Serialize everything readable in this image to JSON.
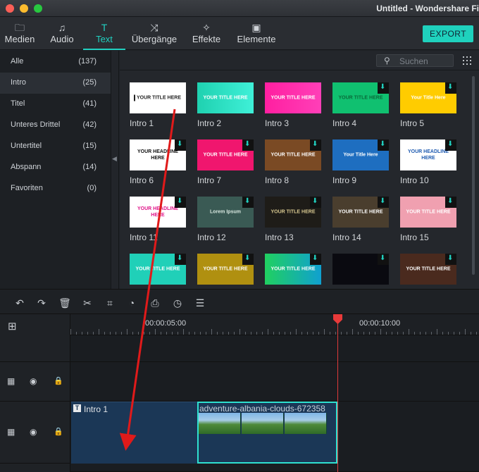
{
  "window": {
    "title": "Untitled - Wondershare Fi"
  },
  "tabs": [
    {
      "label": "Medien",
      "icon": "folder-icon",
      "glyph": "🗀"
    },
    {
      "label": "Audio",
      "icon": "music-note-icon",
      "glyph": "♫"
    },
    {
      "label": "Text",
      "icon": "text-icon",
      "glyph": "T"
    },
    {
      "label": "Übergänge",
      "icon": "transition-icon",
      "glyph": "⤨"
    },
    {
      "label": "Effekte",
      "icon": "effects-icon",
      "glyph": "✧"
    },
    {
      "label": "Elemente",
      "icon": "image-icon",
      "glyph": "▣"
    }
  ],
  "export_label": "EXPORT",
  "categories": [
    {
      "label": "Alle",
      "count": "(137)"
    },
    {
      "label": "Intro",
      "count": "(25)"
    },
    {
      "label": "Titel",
      "count": "(41)"
    },
    {
      "label": "Unteres Drittel",
      "count": "(42)"
    },
    {
      "label": "Untertitel",
      "count": "(15)"
    },
    {
      "label": "Abspann",
      "count": "(14)"
    },
    {
      "label": "Favoriten",
      "count": "(0)"
    }
  ],
  "search": {
    "placeholder": "Suchen"
  },
  "items": [
    {
      "label": "Intro 1",
      "thumb_text": "YOUR TITLE HERE",
      "bg": "#ffffff",
      "fg": "#222222",
      "download": false
    },
    {
      "label": "Intro 2",
      "thumb_text": "YOUR TITLE HERE",
      "bg": "linear-gradient(90deg,#1fd1b0,#3ff0d8)",
      "fg": "#ffffff",
      "download": false
    },
    {
      "label": "Intro 3",
      "thumb_text": "YOUR TITLE HERE",
      "bg": "linear-gradient(90deg,#ff1fa0,#ff3fb8)",
      "fg": "#ffffff",
      "download": false
    },
    {
      "label": "Intro 4",
      "thumb_text": "YOUR TITLE HERE",
      "bg": "#10c070",
      "fg": "#0a6a3a",
      "download": true
    },
    {
      "label": "Intro 5",
      "thumb_text": "Your Title Here",
      "bg": "#ffcc00",
      "fg": "#ffffff",
      "download": true
    },
    {
      "label": "Intro 6",
      "thumb_text": "YOUR HEADLINE HERE",
      "bg": "#ffffff",
      "fg": "#111111",
      "download": true
    },
    {
      "label": "Intro 7",
      "thumb_text": "YOUR TITLE HERE",
      "bg": "#f0166e",
      "fg": "#ffffff",
      "download": true
    },
    {
      "label": "Intro 8",
      "thumb_text": "YOUR TITLE HERE",
      "bg": "#7a4a24",
      "fg": "#ffffff",
      "download": true
    },
    {
      "label": "Intro 9",
      "thumb_text": "Your Title Here",
      "bg": "#1e6ec0",
      "fg": "#ffffff",
      "download": true
    },
    {
      "label": "Intro 10",
      "thumb_text": "YOUR HEADLINE HERE",
      "bg": "#ffffff",
      "fg": "#1e5ab0",
      "download": true
    },
    {
      "label": "Intro 11",
      "thumb_text": "YOUR HEADLINE HERE",
      "bg": "#ffffff",
      "fg": "#e0168a",
      "download": true
    },
    {
      "label": "Intro 12",
      "thumb_text": "Lorem Ipsum",
      "bg": "#3a5a54",
      "fg": "#d8e8e0",
      "download": true
    },
    {
      "label": "Intro 13",
      "thumb_text": "YOUR TITLE HERE",
      "bg": "#1e1c18",
      "fg": "#d8c890",
      "download": true
    },
    {
      "label": "Intro 14",
      "thumb_text": "YOUR TITLE HERE",
      "bg": "#4a3e2e",
      "fg": "#ffffff",
      "download": true
    },
    {
      "label": "Intro 15",
      "thumb_text": "YOUR TITLE HERE",
      "bg": "#f0a0b0",
      "fg": "#ffffff",
      "download": true
    },
    {
      "label": "",
      "thumb_text": "YOUR TITLE HERE",
      "bg": "#20d0b8",
      "fg": "#ffffff",
      "download": true
    },
    {
      "label": "",
      "thumb_text": "YOUR TITLE HERE",
      "bg": "#b09010",
      "fg": "#ffffff",
      "download": true
    },
    {
      "label": "",
      "thumb_text": "YOUR TITLE HERE",
      "bg": "linear-gradient(90deg,#20d060,#10a0d0)",
      "fg": "#ffffff",
      "download": true
    },
    {
      "label": "",
      "thumb_text": "",
      "bg": "#0a0a10",
      "fg": "#ffffff",
      "download": true
    },
    {
      "label": "",
      "thumb_text": "YOUR TITLE HERE",
      "bg": "#4a2a1e",
      "fg": "#ffffff",
      "download": true
    }
  ],
  "edit_tools": [
    {
      "icon": "undo-icon",
      "glyph": "↶"
    },
    {
      "icon": "redo-icon",
      "glyph": "↷"
    },
    {
      "icon": "trash-icon",
      "glyph": "🗑"
    },
    {
      "icon": "scissors-icon",
      "glyph": "✂"
    },
    {
      "icon": "crop-icon",
      "glyph": "⌗"
    },
    {
      "icon": "speed-icon",
      "glyph": "◔"
    },
    {
      "icon": "snapshot-icon",
      "glyph": "⎙"
    },
    {
      "icon": "clock-icon",
      "glyph": "◷"
    },
    {
      "icon": "adjust-icon",
      "glyph": "☰"
    }
  ],
  "timeline": {
    "markers": [
      "00:00:05:00",
      "00:00:10:00"
    ],
    "title_clip": "Intro 1",
    "video_clip": "adventure-albania-clouds-672358"
  },
  "colors": {
    "accent": "#21d0c0",
    "playhead": "#e83a3a",
    "clip_bg": "#1b3756"
  }
}
